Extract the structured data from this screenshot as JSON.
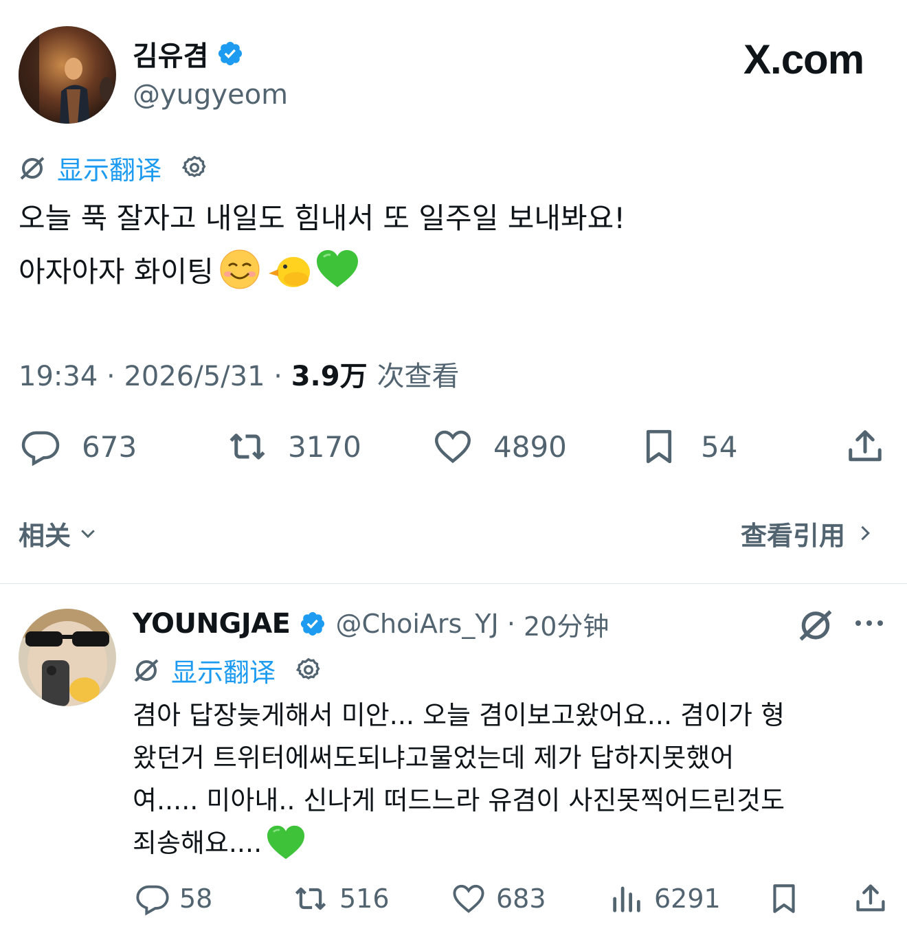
{
  "watermark": "X.com",
  "main_tweet": {
    "display_name": "김유겸",
    "handle": "@yugyeom",
    "translate_label": "显示翻译",
    "text_line1": "오늘 푹 잘자고 내일도 힘내서 또 일주일 보내봐요!",
    "text_line2": "아자아자 화이팅",
    "time": "19:34",
    "date": "2026/5/31",
    "views_count": "3.9万",
    "views_label": "次查看",
    "stats": {
      "replies": "673",
      "retweets": "3170",
      "likes": "4890",
      "bookmarks": "54"
    },
    "related_label": "相关",
    "view_quotes_label": "查看引用"
  },
  "reply_tweet": {
    "display_name": "YOUNGJAE",
    "handle": "@ChoiArs_YJ",
    "time_ago": "20分钟",
    "translate_label": "显示翻译",
    "text_line1": "겸아 답장늦게해서 미안... 오늘 겸이보고왔어요... 겸이가 형",
    "text_line2": "왔던거 트위터에써도되냐고물었는데 제가 답하지못했어",
    "text_line3": "여..... 미아내.. 신나게 떠드느라 유겸이 사진못찍어드린것도",
    "text_line4": "죄송해요....",
    "stats": {
      "replies": "58",
      "retweets": "516",
      "likes": "683",
      "views": "6291"
    }
  },
  "colors": {
    "accent": "#1d9bf0",
    "text": "#0f1419",
    "muted": "#536471",
    "divider": "#e1e6ea"
  },
  "icons": [
    "verified-badge-icon",
    "translate-icon",
    "gear-icon",
    "reply-icon",
    "retweet-icon",
    "like-icon",
    "bookmark-icon",
    "share-icon",
    "views-icon",
    "chevron-down-icon",
    "chevron-right-icon",
    "grok-icon",
    "more-icon",
    "smiling-face-emoji",
    "chick-emoji",
    "green-heart-emoji"
  ]
}
